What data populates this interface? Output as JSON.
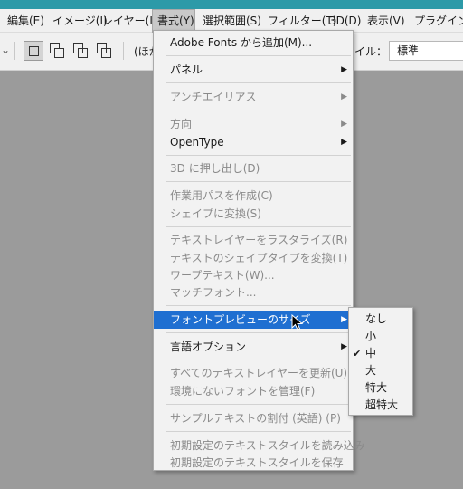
{
  "menubar": {
    "items": [
      "編集(E)",
      "イメージ(I)",
      "レイヤー(L)",
      "書式(Y)",
      "選択範囲(S)",
      "フィルター(T)",
      "3D(D)",
      "表示(V)",
      "プラグイン"
    ]
  },
  "options": {
    "partial_label": "(ほか",
    "style_label": "タイル：",
    "style_value": "標準"
  },
  "type_menu": {
    "items": [
      {
        "label": "Adobe Fonts から追加(M)...",
        "enabled": true,
        "submenu": false
      },
      {
        "label": "パネル",
        "enabled": true,
        "submenu": true
      },
      {
        "label": "アンチエイリアス",
        "enabled": false,
        "submenu": true
      },
      {
        "label": "方向",
        "enabled": false,
        "submenu": true
      },
      {
        "label": "OpenType",
        "enabled": true,
        "submenu": true
      },
      {
        "label": "3D に押し出し(D)",
        "enabled": false,
        "submenu": false
      },
      {
        "label": "作業用パスを作成(C)",
        "enabled": false,
        "submenu": false
      },
      {
        "label": "シェイプに変換(S)",
        "enabled": false,
        "submenu": false
      },
      {
        "label": "テキストレイヤーをラスタライズ(R)",
        "enabled": false,
        "submenu": false
      },
      {
        "label": "テキストのシェイプタイプを変換(T)",
        "enabled": false,
        "submenu": false
      },
      {
        "label": "ワープテキスト(W)...",
        "enabled": false,
        "submenu": false
      },
      {
        "label": "マッチフォント...",
        "enabled": false,
        "submenu": false
      },
      {
        "label": "フォントプレビューのサイズ",
        "enabled": true,
        "submenu": true,
        "highlighted": true
      },
      {
        "label": "言語オプション",
        "enabled": true,
        "submenu": true
      },
      {
        "label": "すべてのテキストレイヤーを更新(U)",
        "enabled": false,
        "submenu": false
      },
      {
        "label": "環境にないフォントを管理(F)",
        "enabled": false,
        "submenu": false
      },
      {
        "label": "サンプルテキストの割付 (英語) (P)",
        "enabled": false,
        "submenu": false
      },
      {
        "label": "初期設定のテキストスタイルを読み込み",
        "enabled": false,
        "submenu": false
      },
      {
        "label": "初期設定のテキストスタイルを保存",
        "enabled": false,
        "submenu": false
      }
    ]
  },
  "preview_size_submenu": {
    "items": [
      {
        "label": "なし",
        "checked": false
      },
      {
        "label": "小",
        "checked": false
      },
      {
        "label": "中",
        "checked": true
      },
      {
        "label": "大",
        "checked": false
      },
      {
        "label": "特大",
        "checked": false
      },
      {
        "label": "超特大",
        "checked": false
      }
    ],
    "check_glyph": "✔"
  },
  "glyphs": {
    "submenu_arrow": "▶",
    "dropdown_chevron": "⌄"
  }
}
